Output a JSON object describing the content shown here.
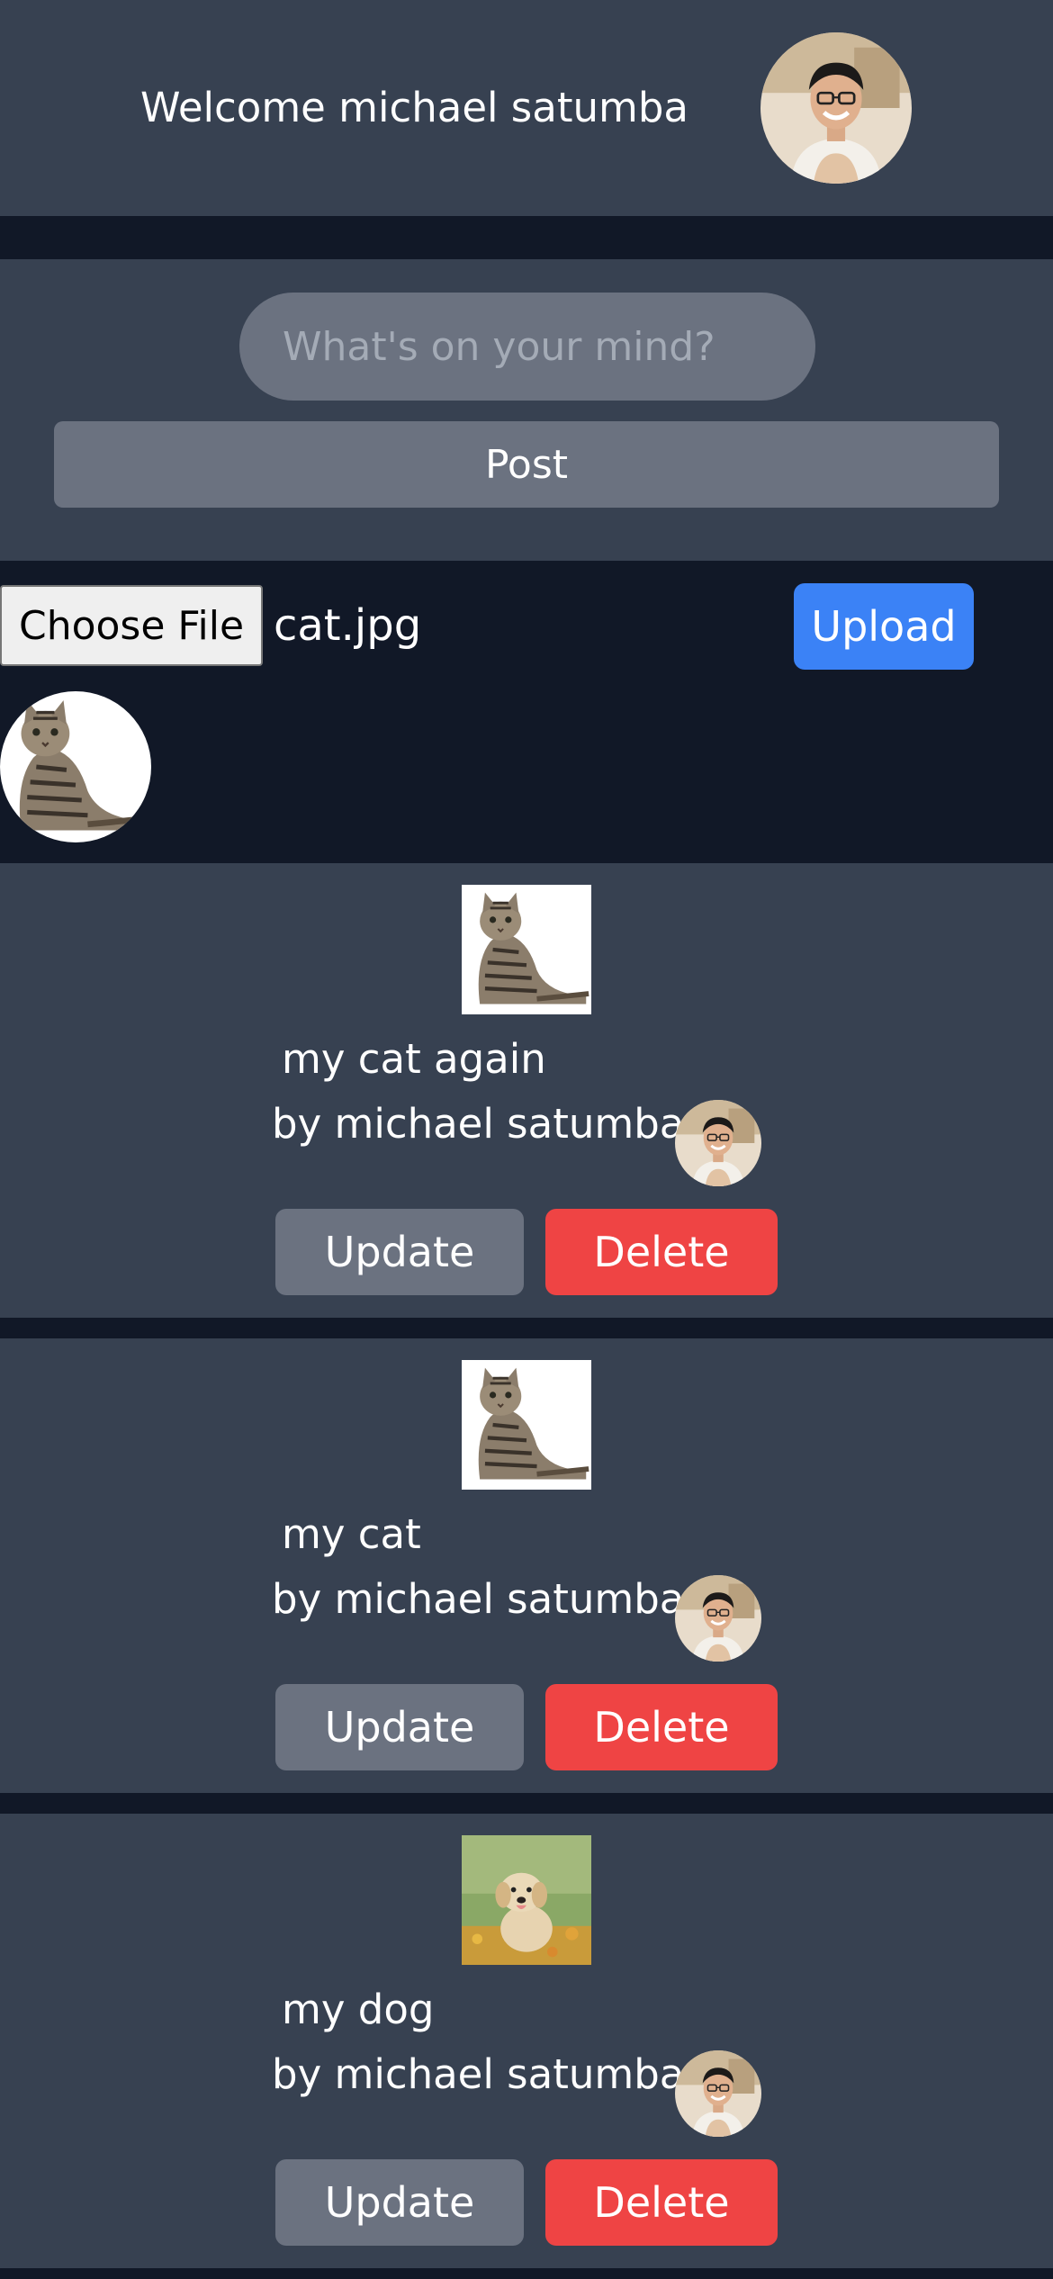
{
  "header": {
    "welcome_text": "Welcome michael satumba"
  },
  "composer": {
    "placeholder": "What's on your mind?",
    "post_label": "Post"
  },
  "upload": {
    "choose_file_label": "Choose File",
    "file_name": "cat.jpg",
    "upload_label": "Upload"
  },
  "posts": [
    {
      "text": "my cat again",
      "author": "by michael satumba",
      "image": "cat-photo",
      "update_label": "Update",
      "delete_label": "Delete"
    },
    {
      "text": "my cat",
      "author": "by michael satumba",
      "image": "cat-photo",
      "update_label": "Update",
      "delete_label": "Delete"
    },
    {
      "text": "my dog",
      "author": "by michael satumba",
      "image": "dog-photo",
      "update_label": "Update",
      "delete_label": "Delete"
    }
  ],
  "colors": {
    "panel": "#374151",
    "background": "#111827",
    "gray_button": "#6b7280",
    "upload_blue": "#3b82f6",
    "delete_red": "#ef4444"
  }
}
